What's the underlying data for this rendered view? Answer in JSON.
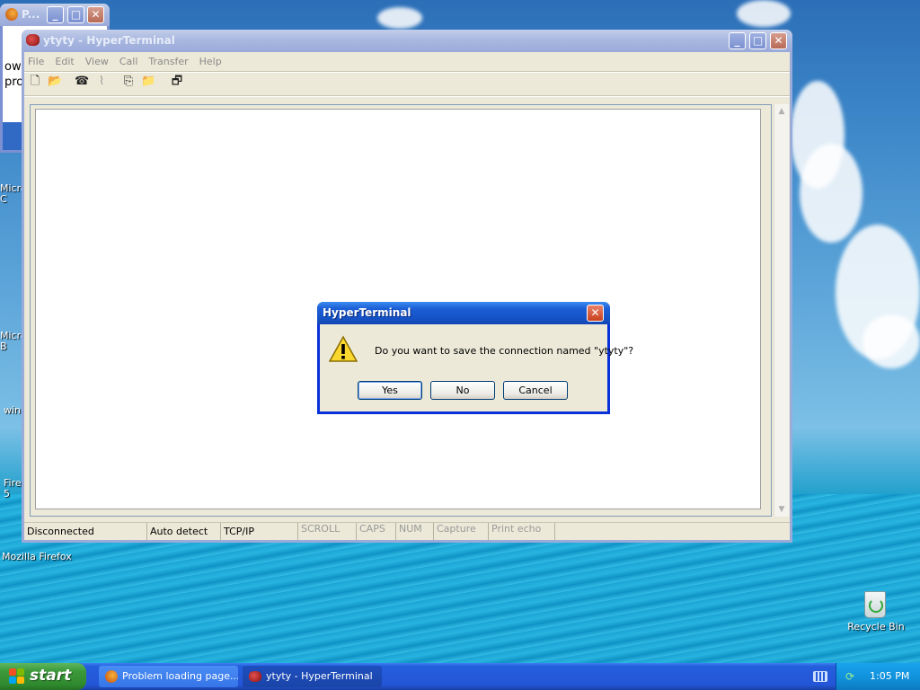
{
  "desktop": {
    "icons": [
      {
        "label": "Micro C",
        "name": "desktop-icon-microsoft-c"
      },
      {
        "label": "Micro B",
        "name": "desktop-icon-microsoft-b"
      },
      {
        "label": "win",
        "name": "desktop-icon-win"
      },
      {
        "label": "Fire 5",
        "name": "desktop-icon-firefox-5"
      },
      {
        "label": "Mozilla Firefox",
        "name": "desktop-icon-mozilla-firefox"
      },
      {
        "label": "Recycle Bin",
        "name": "desktop-icon-recycle-bin"
      }
    ]
  },
  "background_window": {
    "title": "P...",
    "text_lines": [
      "ow",
      "pro"
    ]
  },
  "main_window": {
    "title": "ytyty - HyperTerminal",
    "menu": [
      "File",
      "Edit",
      "View",
      "Call",
      "Transfer",
      "Help"
    ],
    "status": {
      "connection": "Disconnected",
      "emulation": "Auto detect",
      "transport": "TCP/IP",
      "scroll": "SCROLL",
      "caps": "CAPS",
      "num": "NUM",
      "capture": "Capture",
      "print_echo": "Print echo"
    }
  },
  "dialog": {
    "title": "HyperTerminal",
    "message": "Do you want to save the connection named \"ytyty\"?",
    "buttons": {
      "yes": "Yes",
      "no": "No",
      "cancel": "Cancel"
    }
  },
  "taskbar": {
    "start_label": "start",
    "tasks": [
      {
        "label": "Problem loading page..."
      },
      {
        "label": "ytyty - HyperTerminal"
      }
    ],
    "clock": "1:05 PM"
  },
  "colors": {
    "xp_blue": "#245edc",
    "start_green": "#3c9a3b",
    "close_red": "#c8401e",
    "window_face": "#ece9d8"
  }
}
